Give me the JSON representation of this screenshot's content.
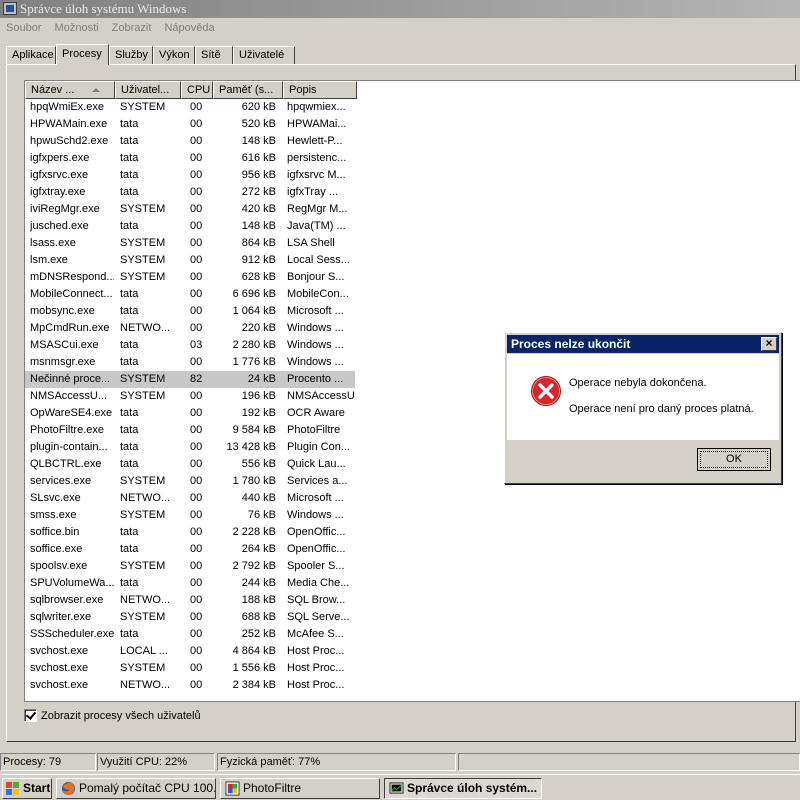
{
  "window": {
    "title": "Správce úloh systému Windows"
  },
  "menu": [
    "Soubor",
    "Možnosti",
    "Zobrazit",
    "Nápověda"
  ],
  "tabs": [
    "Aplikace",
    "Procesy",
    "Služby",
    "Výkon",
    "Sítě",
    "Uživatelé"
  ],
  "active_tab": "Procesy",
  "columns": [
    "Název ...",
    "Uživatel...",
    "CPU",
    "Paměť (s...",
    "Popis"
  ],
  "processes": [
    {
      "name": "hpqWmiEx.exe",
      "user": "SYSTEM",
      "cpu": "00",
      "mem": "620 kB",
      "desc": "hpqwmiex..."
    },
    {
      "name": "HPWAMain.exe",
      "user": "tata",
      "cpu": "00",
      "mem": "520 kB",
      "desc": "HPWAMai..."
    },
    {
      "name": "hpwuSchd2.exe",
      "user": "tata",
      "cpu": "00",
      "mem": "148 kB",
      "desc": "Hewlett-P..."
    },
    {
      "name": "igfxpers.exe",
      "user": "tata",
      "cpu": "00",
      "mem": "616 kB",
      "desc": "persistenc..."
    },
    {
      "name": "igfxsrvc.exe",
      "user": "tata",
      "cpu": "00",
      "mem": "956 kB",
      "desc": "igfxsrvc M..."
    },
    {
      "name": "igfxtray.exe",
      "user": "tata",
      "cpu": "00",
      "mem": "272 kB",
      "desc": "igfxTray ..."
    },
    {
      "name": "iviRegMgr.exe",
      "user": "SYSTEM",
      "cpu": "00",
      "mem": "420 kB",
      "desc": "RegMgr M..."
    },
    {
      "name": "jusched.exe",
      "user": "tata",
      "cpu": "00",
      "mem": "148 kB",
      "desc": "Java(TM) ..."
    },
    {
      "name": "lsass.exe",
      "user": "SYSTEM",
      "cpu": "00",
      "mem": "864 kB",
      "desc": "LSA Shell"
    },
    {
      "name": "lsm.exe",
      "user": "SYSTEM",
      "cpu": "00",
      "mem": "912 kB",
      "desc": "Local Sess..."
    },
    {
      "name": "mDNSRespond...",
      "user": "SYSTEM",
      "cpu": "00",
      "mem": "628 kB",
      "desc": "Bonjour S..."
    },
    {
      "name": "MobileConnect...",
      "user": "tata",
      "cpu": "00",
      "mem": "6 696 kB",
      "desc": "MobileCon..."
    },
    {
      "name": "mobsync.exe",
      "user": "tata",
      "cpu": "00",
      "mem": "1 064 kB",
      "desc": "Microsoft ..."
    },
    {
      "name": "MpCmdRun.exe",
      "user": "NETWO...",
      "cpu": "00",
      "mem": "220 kB",
      "desc": "Windows ..."
    },
    {
      "name": "MSASCui.exe",
      "user": "tata",
      "cpu": "03",
      "mem": "2 280 kB",
      "desc": "Windows ..."
    },
    {
      "name": "msnmsgr.exe",
      "user": "tata",
      "cpu": "00",
      "mem": "1 776 kB",
      "desc": "Windows ..."
    },
    {
      "name": "Nečinné proce...",
      "user": "SYSTEM",
      "cpu": "82",
      "mem": "24 kB",
      "desc": "Procento ...",
      "selected": true
    },
    {
      "name": "NMSAccessU...",
      "user": "SYSTEM",
      "cpu": "00",
      "mem": "196 kB",
      "desc": "NMSAccessU"
    },
    {
      "name": "OpWareSE4.exe",
      "user": "tata",
      "cpu": "00",
      "mem": "192 kB",
      "desc": "OCR Aware"
    },
    {
      "name": "PhotoFiltre.exe",
      "user": "tata",
      "cpu": "00",
      "mem": "9 584 kB",
      "desc": "PhotoFiltre"
    },
    {
      "name": "plugin-contain...",
      "user": "tata",
      "cpu": "00",
      "mem": "13 428 kB",
      "desc": "Plugin Con..."
    },
    {
      "name": "QLBCTRL.exe",
      "user": "tata",
      "cpu": "00",
      "mem": "556 kB",
      "desc": "Quick Lau..."
    },
    {
      "name": "services.exe",
      "user": "SYSTEM",
      "cpu": "00",
      "mem": "1 780 kB",
      "desc": "Services a..."
    },
    {
      "name": "SLsvc.exe",
      "user": "NETWO...",
      "cpu": "00",
      "mem": "440 kB",
      "desc": "Microsoft ..."
    },
    {
      "name": "smss.exe",
      "user": "SYSTEM",
      "cpu": "00",
      "mem": "76 kB",
      "desc": "Windows ..."
    },
    {
      "name": "soffice.bin",
      "user": "tata",
      "cpu": "00",
      "mem": "2 228 kB",
      "desc": "OpenOffic..."
    },
    {
      "name": "soffice.exe",
      "user": "tata",
      "cpu": "00",
      "mem": "264 kB",
      "desc": "OpenOffic..."
    },
    {
      "name": "spoolsv.exe",
      "user": "SYSTEM",
      "cpu": "00",
      "mem": "2 792 kB",
      "desc": "Spooler S..."
    },
    {
      "name": "SPUVolumeWa...",
      "user": "tata",
      "cpu": "00",
      "mem": "244 kB",
      "desc": "Media Che..."
    },
    {
      "name": "sqlbrowser.exe",
      "user": "NETWO...",
      "cpu": "00",
      "mem": "188 kB",
      "desc": "SQL Brow..."
    },
    {
      "name": "sqlwriter.exe",
      "user": "SYSTEM",
      "cpu": "00",
      "mem": "688 kB",
      "desc": "SQL Serve..."
    },
    {
      "name": "SSScheduler.exe",
      "user": "tata",
      "cpu": "00",
      "mem": "252 kB",
      "desc": "McAfee S..."
    },
    {
      "name": "svchost.exe",
      "user": "LOCAL ...",
      "cpu": "00",
      "mem": "4 864 kB",
      "desc": "Host Proc..."
    },
    {
      "name": "svchost.exe",
      "user": "SYSTEM",
      "cpu": "00",
      "mem": "1 556 kB",
      "desc": "Host Proc..."
    },
    {
      "name": "svchost.exe",
      "user": "NETWO...",
      "cpu": "00",
      "mem": "2 384 kB",
      "desc": "Host Proc..."
    }
  ],
  "show_all_users": {
    "label": "Zobrazit procesy všech uživatelů",
    "checked": true
  },
  "status": {
    "processes": "Procesy: 79",
    "cpu": "Využití CPU: 22%",
    "memory": "Fyzická paměť: 77%"
  },
  "taskbar": {
    "start": "Start",
    "buttons": [
      {
        "label": "Pomalý počítač CPU 100...",
        "icon": "firefox-icon"
      },
      {
        "label": "PhotoFiltre",
        "icon": "photofiltre-icon"
      },
      {
        "label": "Správce úloh systém...",
        "icon": "task-manager-icon",
        "active": true
      }
    ]
  },
  "dialog": {
    "title": "Proces nelze ukončit",
    "line1": "Operace nebyla dokončena.",
    "line2": "Operace není pro daný proces platná.",
    "ok": "OK",
    "icon": "error-icon"
  },
  "colors": {
    "dialog_title_bg": "#0a246a",
    "error_red": "#d9252a",
    "selected_row": "#c8c8c8"
  }
}
